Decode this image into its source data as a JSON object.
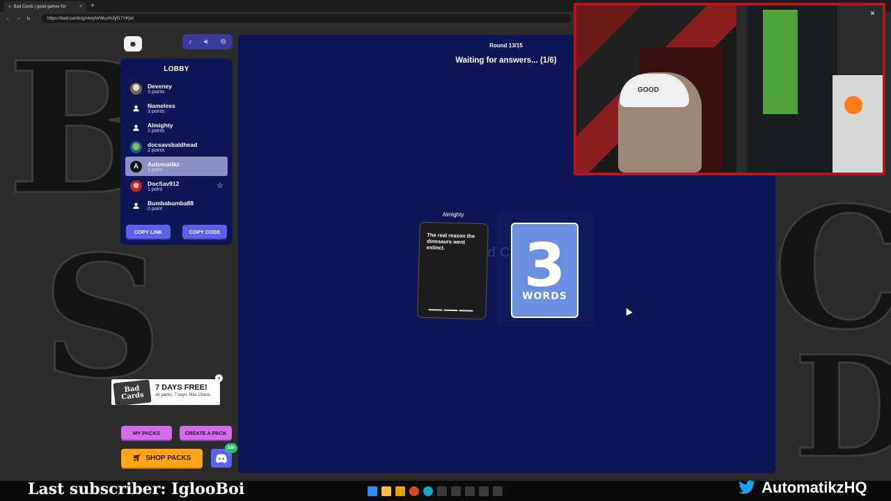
{
  "browser": {
    "tab_title": "Bad Cards | good games for",
    "url": "https://bad.cards/g/nlwyNrWuoNJyf17YKjeI"
  },
  "sidebar": {
    "lobby_title": "LOBBY",
    "players": [
      {
        "name": "Deveney",
        "points": "3 points",
        "avatar": "photo"
      },
      {
        "name": "Nameless",
        "points": "3 points",
        "avatar": "user-icon"
      },
      {
        "name": "Almighty",
        "points": "2 points",
        "avatar": "user-icon"
      },
      {
        "name": "docsavsbaldhead",
        "points": "2 points",
        "avatar": "turtle"
      },
      {
        "name": "Automatikz",
        "points": "1 point",
        "avatar": "A",
        "active": true
      },
      {
        "name": "DocSav912",
        "points": "1 point",
        "avatar": "red",
        "star": true
      },
      {
        "name": "Bumbabumba88",
        "points": "0 point",
        "avatar": "user-icon"
      }
    ],
    "copy_link": "COPY LINK",
    "copy_code": "COPY CODE"
  },
  "promo": {
    "logo_text": "Bad Cards",
    "title": "7 DAYS FREE!",
    "subtitle": "All packs, 7 days. Max Chaos."
  },
  "actions": {
    "my_packs": "MY PACKS",
    "create_pack": "CREATE A PACK",
    "shop_packs": "SHOP PACKS",
    "discord_badge": "220"
  },
  "game": {
    "round": "Round 13/15",
    "status": "Waiting for answers... (1/6)",
    "card_owner": "Almighty",
    "prompt": "The real reason the dinosaurs went extinct.",
    "ghost_text": "d C",
    "blue_card_number": "3",
    "blue_card_word": "WORDS"
  },
  "overlay": {
    "last_subscriber": "Last subscriber: IglooBoi",
    "handle": "AutomatikzHQ",
    "cap_text": "GOOD"
  },
  "colors": {
    "board": "#0d1554",
    "lobby_bg": "#0f1656",
    "blue_button": "#5a61e6",
    "purple_button": "#d46be8",
    "shop_button": "#ffa41b",
    "blue_card": "#6a8fe0",
    "cam_border": "#b3161b"
  }
}
